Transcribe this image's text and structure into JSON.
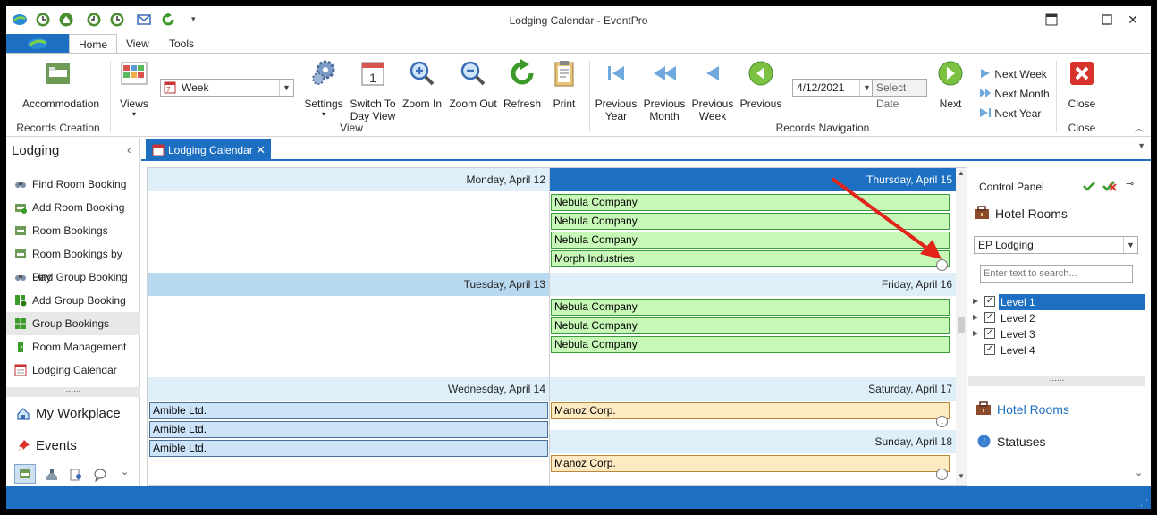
{
  "window": {
    "title": "Lodging Calendar - EventPro"
  },
  "ribbon_tabs": [
    "Home",
    "View",
    "Tools"
  ],
  "ribbon": {
    "accommodation": "Accommodation",
    "records_creation": "Records Creation",
    "views": "Views",
    "view_select": "Week",
    "view_select_icon_text": "7",
    "settings": "Settings",
    "switch_day_1": "Switch To",
    "switch_day_2": "Day View",
    "zoom_in": "Zoom In",
    "zoom_out": "Zoom Out",
    "refresh": "Refresh",
    "print": "Print",
    "view_group": "View",
    "prev_year_1": "Previous",
    "prev_year_2": "Year",
    "prev_month_1": "Previous",
    "prev_month_2": "Month",
    "prev_week_1": "Previous",
    "prev_week_2": "Week",
    "previous": "Previous",
    "date_value": "4/12/2021",
    "select_date": "Select Date",
    "next": "Next",
    "next_week": "Next Week",
    "next_month": "Next Month",
    "next_year": "Next Year",
    "records_navigation": "Records Navigation",
    "close": "Close",
    "close_group": "Close"
  },
  "nav": {
    "title": "Lodging",
    "items": [
      "Find Room Booking",
      "Add Room Booking",
      "Room Bookings",
      "Room Bookings by Day",
      "Find Group Booking",
      "Add Group Booking",
      "Group Bookings",
      "Room Management",
      "Lodging Calendar"
    ],
    "my_workplace": "My Workplace",
    "events": "Events",
    "splitter": "......"
  },
  "doc_tab": {
    "label": "Lodging Calendar"
  },
  "calendar": {
    "days": [
      "Monday, April 12",
      "Tuesday, April 13",
      "Wednesday, April 14",
      "Thursday, April 15",
      "Friday, April 16",
      "Saturday, April 17",
      "Sunday, April 18"
    ],
    "thursday_appts": [
      "Nebula Company",
      "Nebula Company",
      "Nebula Company",
      "Morph Industries"
    ],
    "friday_appts": [
      "Nebula Company",
      "Nebula Company",
      "Nebula Company"
    ],
    "wednesday_appts": [
      "Amible Ltd.",
      "Amible Ltd.",
      "Amible Ltd."
    ],
    "saturday_appts": [
      "Manoz Corp."
    ],
    "sunday_appts": [
      "Manoz Corp."
    ]
  },
  "control_panel": {
    "title": "Control Panel",
    "hotel_rooms": "Hotel Rooms",
    "lodging_select": "EP Lodging",
    "search_placeholder": "Enter text to search...",
    "levels": [
      "Level 1",
      "Level 2",
      "Level 3",
      "Level 4"
    ],
    "splitter": "......",
    "hotel_rooms_link": "Hotel Rooms",
    "statuses": "Statuses"
  },
  "colors": {
    "accent": "#1d6fc1",
    "green_appt": "#c8f8b8",
    "blue_appt": "#cde3f8",
    "orange_appt": "#fde9c2"
  }
}
